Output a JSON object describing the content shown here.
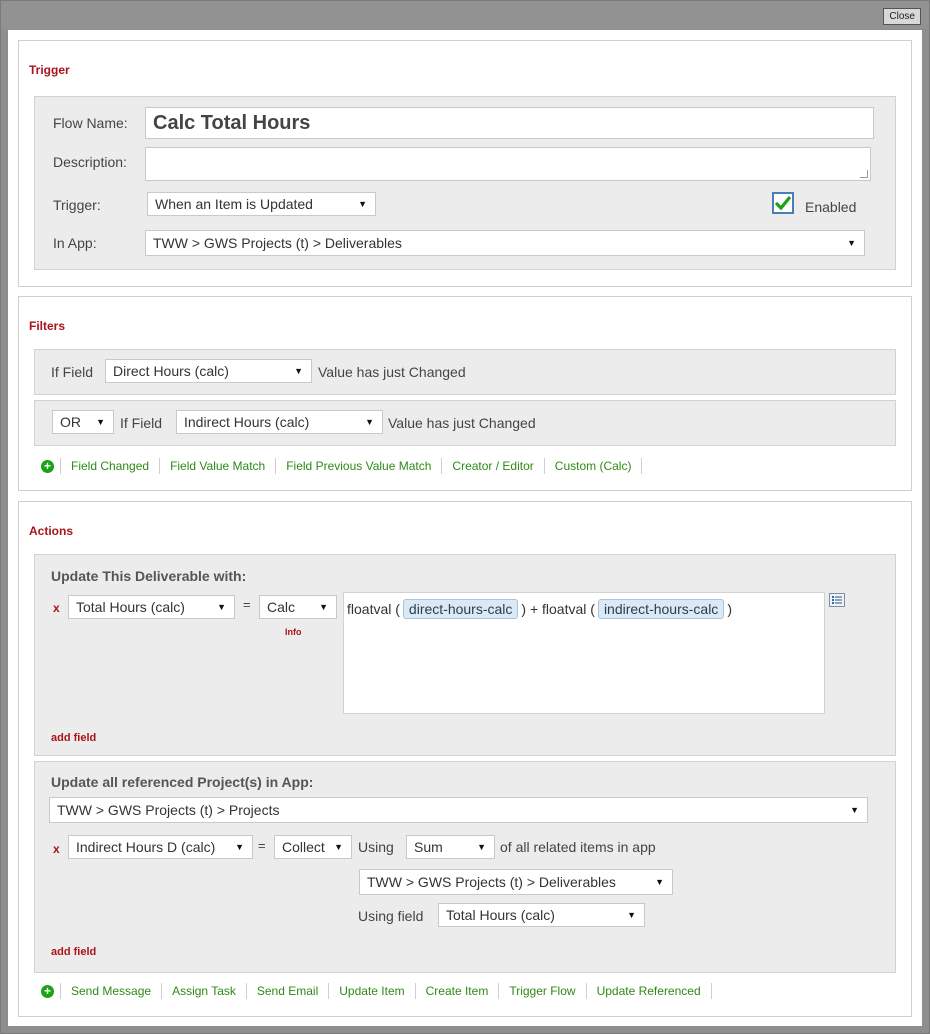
{
  "window": {
    "close_label": "Close"
  },
  "trigger": {
    "section_title": "Trigger",
    "flow_name_label": "Flow Name:",
    "flow_name_value": "Calc Total Hours",
    "description_label": "Description:",
    "description_value": "",
    "trigger_label": "Trigger:",
    "trigger_value": "When an Item is Updated",
    "enabled_label": "Enabled",
    "enabled_checked": true,
    "in_app_label": "In App:",
    "in_app_value": "TWW > GWS Projects (t) > Deliverables"
  },
  "filters": {
    "section_title": "Filters",
    "rows": [
      {
        "connector": "",
        "if_field_label": "If Field",
        "field": "Direct Hours (calc)",
        "condition": "Value has just Changed"
      },
      {
        "connector": "OR",
        "if_field_label": "If Field",
        "field": "Indirect Hours (calc)",
        "condition": "Value has just Changed"
      }
    ],
    "links": [
      "Field Changed",
      "Field Value Match",
      "Field Previous Value Match",
      "Creator / Editor",
      "Custom (Calc)"
    ]
  },
  "actions": {
    "section_title": "Actions",
    "update_this": {
      "title": "Update This Deliverable with:",
      "remove_label": "x",
      "field": "Total Hours (calc)",
      "equals": "=",
      "mode": "Calc",
      "info_label": "Info",
      "formula": {
        "fn1": "floatval (",
        "token1": "direct-hours-calc",
        "mid": ") + floatval (",
        "token2": "indirect-hours-calc",
        "end": ")"
      },
      "add_field_label": "add field"
    },
    "update_referenced": {
      "title": "Update all referenced Project(s) in App:",
      "app": "TWW > GWS Projects (t) > Projects",
      "remove_label": "x",
      "field": "Indirect Hours D (calc)",
      "equals": "=",
      "mode": "Collect",
      "using_label": "Using",
      "agg": "Sum",
      "related_label": "of all related items in app",
      "related_app": "TWW > GWS Projects (t) > Deliverables",
      "using_field_label": "Using field",
      "using_field": "Total Hours (calc)",
      "add_field_label": "add field"
    },
    "links": [
      "Send Message",
      "Assign Task",
      "Send Email",
      "Update Item",
      "Create Item",
      "Trigger Flow",
      "Update Referenced"
    ]
  },
  "colors": {
    "section_title": "#a8141a",
    "link": "#2f8a16",
    "chip_bg": "#dbe9f5",
    "check": "#1aa316"
  },
  "icons": {
    "add": "plus-circle-icon",
    "dropdown": "chevron-down-icon",
    "field_picker": "field-list-icon",
    "enabled": "checkbox-checked-icon"
  }
}
